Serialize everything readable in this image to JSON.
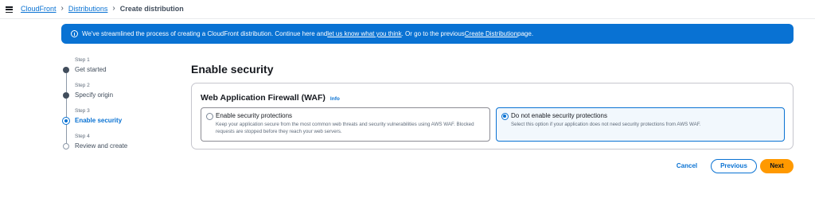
{
  "breadcrumb": {
    "items": [
      "CloudFront",
      "Distributions"
    ],
    "current": "Create distribution"
  },
  "banner": {
    "text_1": "We've streamlined the process of creating a CloudFront distribution. Continue here and ",
    "link_1": "let us know what you think",
    "text_2": ". Or go to the previous ",
    "link_2": "Create Distribution",
    "text_3": " page."
  },
  "steps": [
    {
      "num": "Step 1",
      "label": "Get started",
      "state": "done"
    },
    {
      "num": "Step 2",
      "label": "Specify origin",
      "state": "done"
    },
    {
      "num": "Step 3",
      "label": "Enable security",
      "state": "active"
    },
    {
      "num": "Step 4",
      "label": "Review and create",
      "state": "future"
    }
  ],
  "page_title": "Enable security",
  "waf": {
    "title": "Web Application Firewall (WAF)",
    "info": "Info",
    "options": [
      {
        "title": "Enable security protections",
        "desc": "Keep your application secure from the most common web threats and security vulnerabilities using AWS WAF. Blocked requests are stopped before they reach your web servers.",
        "selected": false
      },
      {
        "title": "Do not enable security protections",
        "desc": "Select this option if your application does not need security protections from AWS WAF.",
        "selected": true
      }
    ]
  },
  "buttons": {
    "cancel": "Cancel",
    "previous": "Previous",
    "next": "Next"
  },
  "colors": {
    "accent": "#0972d3",
    "primary_button": "#ff9900"
  }
}
